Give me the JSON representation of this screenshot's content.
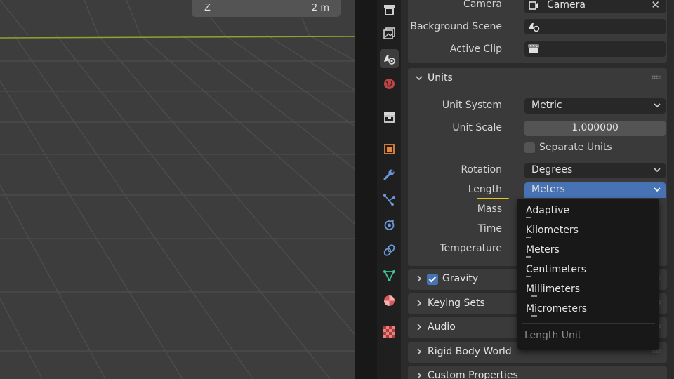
{
  "viewport": {
    "nav_axis": "Z",
    "nav_value": "2 m",
    "colors": {
      "background": "#3d3d3d",
      "grid": "#545454",
      "x_axis": "#8aa52e"
    }
  },
  "tabs": [
    {
      "icon": "render-output-icon",
      "active": false
    },
    {
      "icon": "view-layer-icon",
      "active": false
    },
    {
      "icon": "scene-icon",
      "active": true
    },
    {
      "icon": "world-icon",
      "active": false
    },
    {
      "icon": "collection-icon",
      "active": false
    },
    {
      "icon": "object-icon",
      "active": false
    },
    {
      "icon": "modifier-wrench-icon",
      "active": false
    },
    {
      "icon": "particles-icon",
      "active": false
    },
    {
      "icon": "physics-icon",
      "active": false
    },
    {
      "icon": "constraints-icon",
      "active": false
    },
    {
      "icon": "object-data-icon",
      "active": false
    },
    {
      "icon": "material-icon",
      "active": false
    },
    {
      "icon": "texture-icon",
      "active": false
    }
  ],
  "scene": {
    "camera_label": "Camera",
    "camera_value": "Camera",
    "background_scene_label": "Background Scene",
    "active_clip_label": "Active Clip"
  },
  "units": {
    "title": "Units",
    "unit_system_label": "Unit System",
    "unit_system_value": "Metric",
    "unit_scale_label": "Unit Scale",
    "unit_scale_value": "1.000000",
    "separate_units_label": "Separate Units",
    "rotation_label": "Rotation",
    "rotation_value": "Degrees",
    "length_label": "Length",
    "length_value": "Meters",
    "mass_label": "Mass",
    "time_label": "Time",
    "temperature_label": "Temperature"
  },
  "dropdown": {
    "options": [
      "Adaptive",
      "Kilometers",
      "Meters",
      "Centimeters",
      "Millimeters",
      "Micrometers"
    ],
    "footer": "Length Unit"
  },
  "panels": {
    "gravity": "Gravity",
    "keying_sets": "Keying Sets",
    "audio": "Audio",
    "rigid_body_world": "Rigid Body World",
    "custom_properties": "Custom Properties"
  },
  "accent_colors": {
    "selected": "#4772b3",
    "checkbox": "#4772b3",
    "underline": "#e6c619"
  }
}
